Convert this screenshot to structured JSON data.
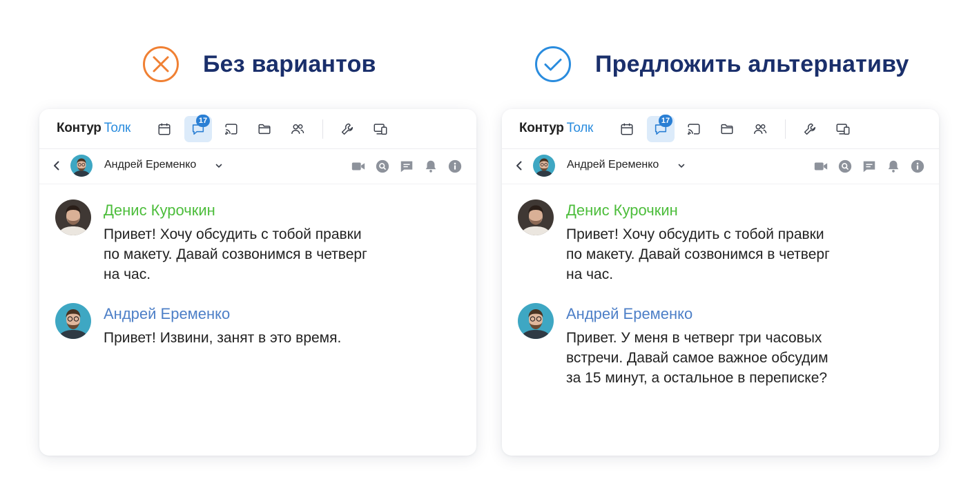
{
  "colors": {
    "heading": "#1a2f6b",
    "bad": "#f08033",
    "good": "#2a8cde",
    "author_denis": "#4cbd3b",
    "author_andrey": "#4d7fc7",
    "brand_accent": "#2a8cde",
    "badge": "#2a7fd4"
  },
  "panels": [
    {
      "heading": {
        "icon": "x-circle-icon",
        "title": "Без вариантов"
      },
      "app": {
        "brand": {
          "part1": "Контур",
          "part2": "Толк"
        },
        "toolbar": {
          "items": [
            "calendar-icon",
            "chat-icon",
            "cast-icon",
            "folder-icon",
            "people-icon",
            "wrench-icon",
            "devices-icon"
          ],
          "active": "chat-icon",
          "badge": "17"
        },
        "chat_header": {
          "name": "Андрей Еременко",
          "actions": [
            "video-icon",
            "search-icon",
            "thread-icon",
            "bell-icon",
            "info-icon"
          ]
        },
        "messages": [
          {
            "author": "Денис Курочкин",
            "lines": [
              "Привет! Хочу обсудить с тобой правки",
              "по макету. Давай созвонимся в четверг",
              "на час."
            ]
          },
          {
            "author": "Андрей Еременко",
            "lines": [
              "Привет! Извини, занят в это время."
            ]
          }
        ]
      }
    },
    {
      "heading": {
        "icon": "check-circle-icon",
        "title": "Предложить альтернативу"
      },
      "app": {
        "brand": {
          "part1": "Контур",
          "part2": "Толк"
        },
        "toolbar": {
          "items": [
            "calendar-icon",
            "chat-icon",
            "cast-icon",
            "folder-icon",
            "people-icon",
            "wrench-icon",
            "devices-icon"
          ],
          "active": "chat-icon",
          "badge": "17"
        },
        "chat_header": {
          "name": "Андрей Еременко",
          "actions": [
            "video-icon",
            "search-icon",
            "thread-icon",
            "bell-icon",
            "info-icon"
          ]
        },
        "messages": [
          {
            "author": "Денис Курочкин",
            "lines": [
              "Привет! Хочу обсудить с тобой правки",
              "по макету. Давай созвонимся в четверг",
              "на час."
            ]
          },
          {
            "author": "Андрей Еременко",
            "lines": [
              "Привет. У меня в четверг три часовых",
              "встречи. Давай самое важное обсудим",
              "за 15 минут, а остальное в переписке?"
            ]
          }
        ]
      }
    }
  ]
}
